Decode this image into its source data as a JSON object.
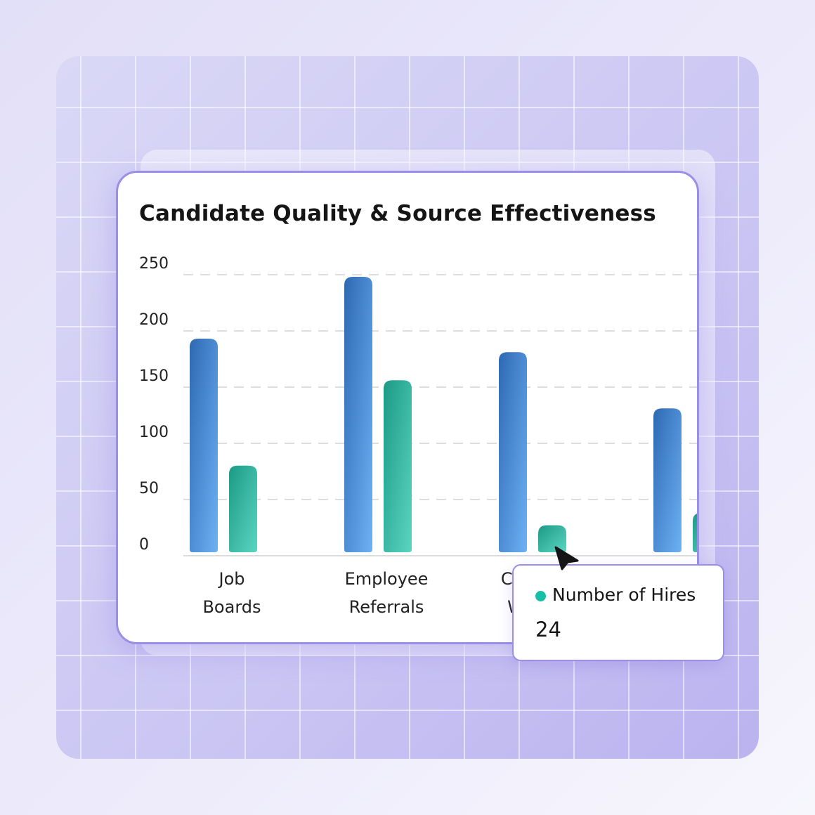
{
  "colors": {
    "hires_bar": "#1fa08b",
    "applicants_bar": "#3b7cc8",
    "card_border": "#9a8fe6",
    "tooltip_dot": "#16bfa5"
  },
  "chart_data": {
    "type": "bar",
    "title": "Candidate Quality & Source Effectiveness",
    "categories": [
      [
        "Job",
        "Boards"
      ],
      [
        "Employee",
        "Referrals"
      ],
      [
        "Company",
        "Website"
      ],
      [
        "",
        ""
      ]
    ],
    "series": [
      {
        "values": [
          190,
          245,
          178,
          128
        ]
      },
      {
        "name": "Number of Hires",
        "values": [
          77,
          153,
          24,
          35
        ]
      }
    ],
    "ylim": [
      0,
      250
    ],
    "yticks": [
      "0",
      "50",
      "100",
      "150",
      "200",
      "250"
    ],
    "grid": "horizontal dashed"
  },
  "tooltip": {
    "series": "Number of Hires",
    "value": "24"
  },
  "icons": {
    "cursor": "arrow-pointer-icon"
  }
}
